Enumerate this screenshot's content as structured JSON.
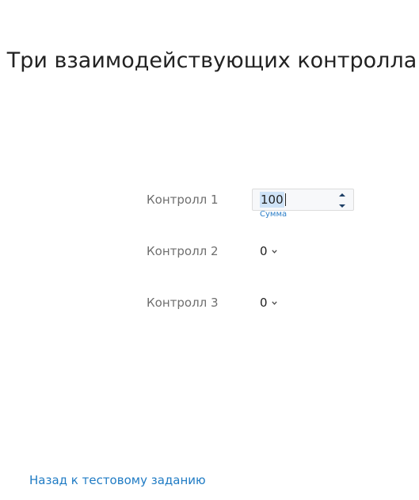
{
  "page": {
    "title": "Три взаимодействующих контролла"
  },
  "controls": [
    {
      "label": "Контролл 1",
      "value": "100",
      "hint": "Сумма"
    },
    {
      "label": "Контролл 2",
      "value": "0"
    },
    {
      "label": "Контролл 3",
      "value": "0"
    }
  ],
  "icons": {
    "spinner_up": "spinner-up-icon",
    "spinner_down": "spinner-down-icon",
    "dropdown": "chevron-down-icon"
  },
  "colors": {
    "link": "#1f7bc4",
    "hint": "#2d7fc8",
    "label": "#6f6f6f",
    "selection": "#cfe3f7"
  },
  "footer": {
    "back_link": "Назад к тестовому заданию"
  }
}
